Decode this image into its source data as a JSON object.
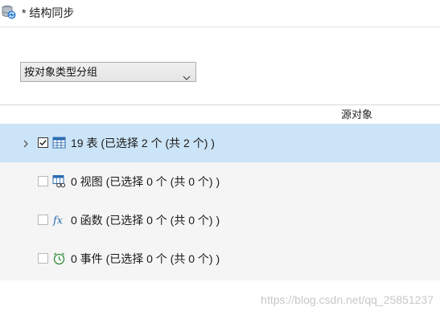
{
  "titlebar": {
    "icon": "database-sync-icon",
    "title": "* 结构同步"
  },
  "group_select": {
    "value": "按对象类型分组",
    "icon": "chevron-down-icon"
  },
  "column_header": {
    "label": "源对象"
  },
  "tree_rows": [
    {
      "label": "19 表 (已选择 2 个 (共 2 个) )",
      "icon": "table-icon",
      "checked": true,
      "selected": true,
      "expander": "chevron-right-icon"
    },
    {
      "label": "0 视图 (已选择 0 个 (共 0 个) )",
      "icon": "view-icon",
      "checked": false,
      "selected": false
    },
    {
      "label": "0 函数 (已选择 0 个 (共 0 个) )",
      "icon": "function-icon",
      "checked": false,
      "selected": false
    },
    {
      "label": "0 事件 (已选择 0 个 (共 0 个) )",
      "icon": "event-icon",
      "checked": false,
      "selected": false
    }
  ],
  "watermark": "https://blog.csdn.net/qq_25851237",
  "colors": {
    "selected_row": "#cce4f7",
    "tree_background": "#f5f5f5",
    "icon_blue": "#2b6cb0"
  }
}
